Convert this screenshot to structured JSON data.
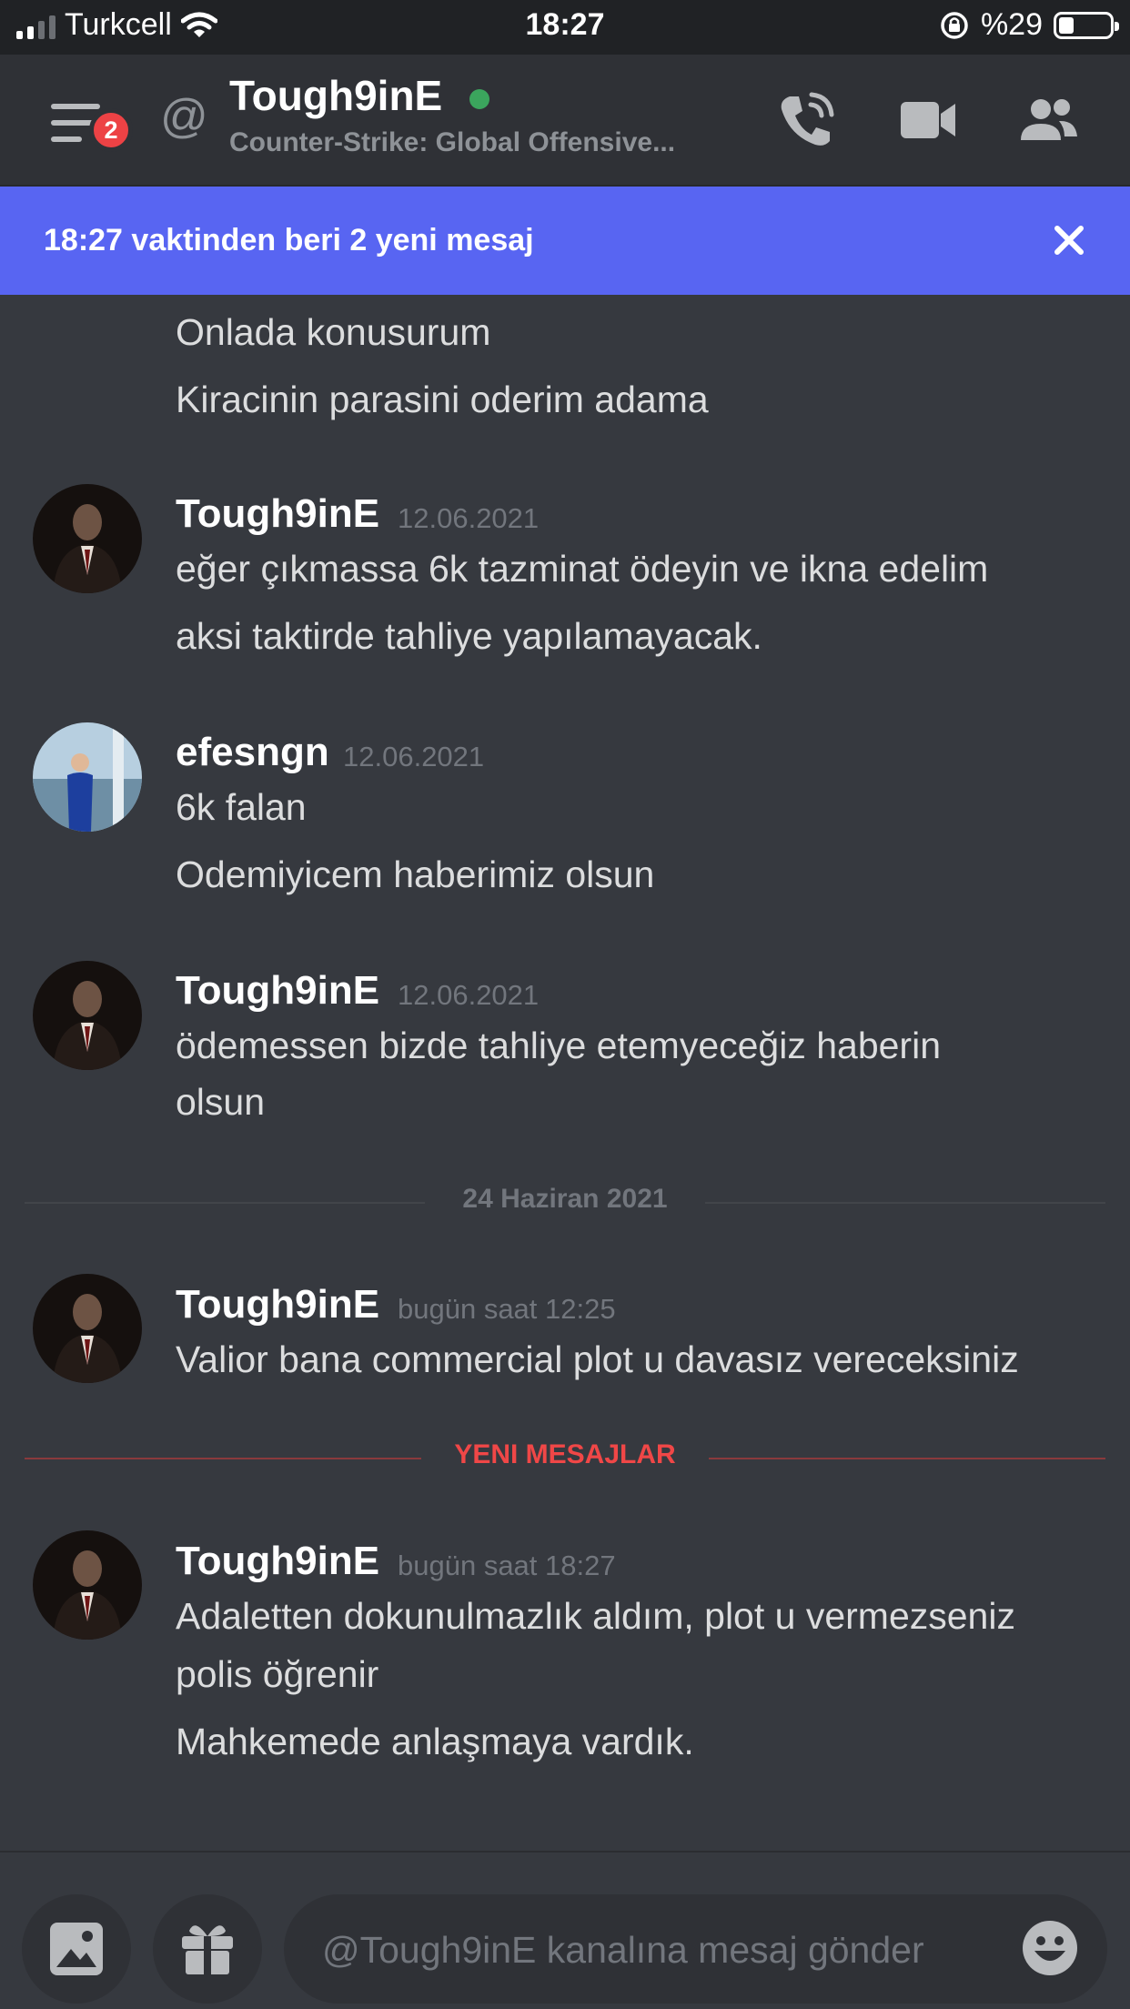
{
  "status_bar": {
    "carrier": "Turkcell",
    "time": "18:27",
    "battery_text": "%29",
    "battery_level": 0.29
  },
  "header": {
    "menu_badge": "2",
    "at_symbol": "@",
    "title": "Tough9inE",
    "subtitle": "Counter-Strike: Global Offensive...",
    "icons": [
      "menu-icon",
      "phone-call-icon",
      "video-camera-icon",
      "people-icon"
    ]
  },
  "banner": {
    "text": "18:27 vaktinden beri 2 yeni mesaj",
    "close_icon": "close-icon"
  },
  "colors": {
    "background": "#36393f",
    "header": "#2f3136",
    "banner": "#5865f2",
    "online": "#3ba55d",
    "badge": "#ed4245",
    "new_messages": "#f04747"
  },
  "messages": {
    "m0": {
      "lines": [
        "Onlada konusurum",
        "Kiracinin parasini oderim adama"
      ]
    },
    "m1": {
      "author": "Tough9inE",
      "timestamp": "12.06.2021",
      "lines": [
        "eğer çıkmassa 6k tazminat ödeyin ve ikna edelim",
        "aksi taktirde tahliye yapılamayacak."
      ]
    },
    "m2": {
      "author": "efesngn",
      "timestamp": "12.06.2021",
      "lines": [
        "6k falan",
        "Odemiyicem haberimiz olsun"
      ]
    },
    "m3": {
      "author": "Tough9inE",
      "timestamp": "12.06.2021",
      "lines": [
        "ödemessen bizde tahliye etemyeceğiz haberin",
        "olsun"
      ]
    },
    "date_divider": "24 Haziran 2021",
    "m4": {
      "author": "Tough9inE",
      "timestamp": "bugün saat 12:25",
      "lines": [
        "Valior bana commercial plot u davasız vereceksiniz"
      ]
    },
    "new_divider": "YENI MESAJLAR",
    "m5": {
      "author": "Tough9inE",
      "timestamp": "bugün saat 18:27",
      "lines": [
        "Adaletten dokunulmazlık aldım, plot u vermezseniz",
        "polis öğrenir",
        "Mahkemede anlaşmaya vardık."
      ]
    }
  },
  "composer": {
    "placeholder": "@Tough9inE kanalına mesaj gönder",
    "icons": [
      "image-icon",
      "gift-icon",
      "emoji-icon"
    ]
  }
}
